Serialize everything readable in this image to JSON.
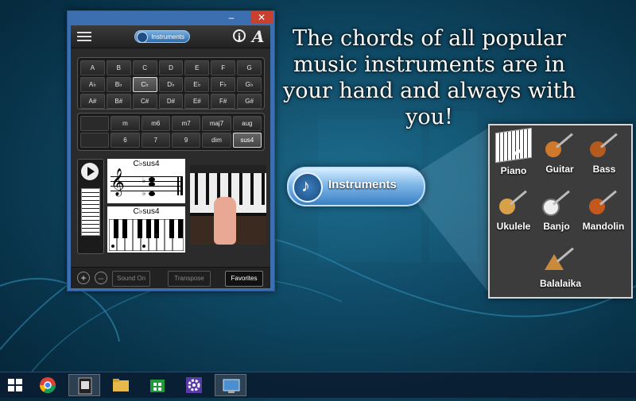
{
  "headline": "The chords of all popular music instruments are in your hand and always with you!",
  "app": {
    "toolbar": {
      "instruments_label": "Instruments",
      "info_glyph": "i",
      "font_glyph": "A"
    },
    "notes": [
      [
        "A",
        "B",
        "C",
        "D",
        "E",
        "F",
        "G"
      ],
      [
        "A♭",
        "B♭",
        "C♭",
        "D♭",
        "E♭",
        "F♭",
        "G♭"
      ],
      [
        "A#",
        "B#",
        "C#",
        "D#",
        "E#",
        "F#",
        "G#"
      ]
    ],
    "selected_note": "C♭",
    "chord_types": [
      [
        "",
        "m",
        "m6",
        "m7",
        "maj7",
        "aug"
      ],
      [
        "",
        "6",
        "7",
        "9",
        "dim",
        "sus4"
      ]
    ],
    "selected_chord_type": "sus4",
    "chord_name": "C♭sus4",
    "footer": {
      "plus": "+",
      "minus": "–",
      "sound_on": "Sound On",
      "transpose": "Transpose",
      "favorites": "Favorites"
    }
  },
  "big_button_label": "Instruments",
  "instruments": [
    "Piano",
    "Guitar",
    "Bass",
    "Ukulele",
    "Banjo",
    "Mandolin",
    "Balalaika"
  ],
  "selected_instrument": "Piano",
  "icons": {
    "window": [
      "minimize-icon",
      "maximize-icon",
      "close-icon"
    ],
    "taskbar": [
      "windows-start-icon",
      "chrome-icon",
      "chord-app-icon",
      "file-explorer-icon",
      "store-icon",
      "settings-icon",
      "control-panel-icon"
    ]
  },
  "colors": {
    "accent": "#3b6fb0",
    "close": "#c9402f",
    "desktop": "#0f4a66"
  }
}
